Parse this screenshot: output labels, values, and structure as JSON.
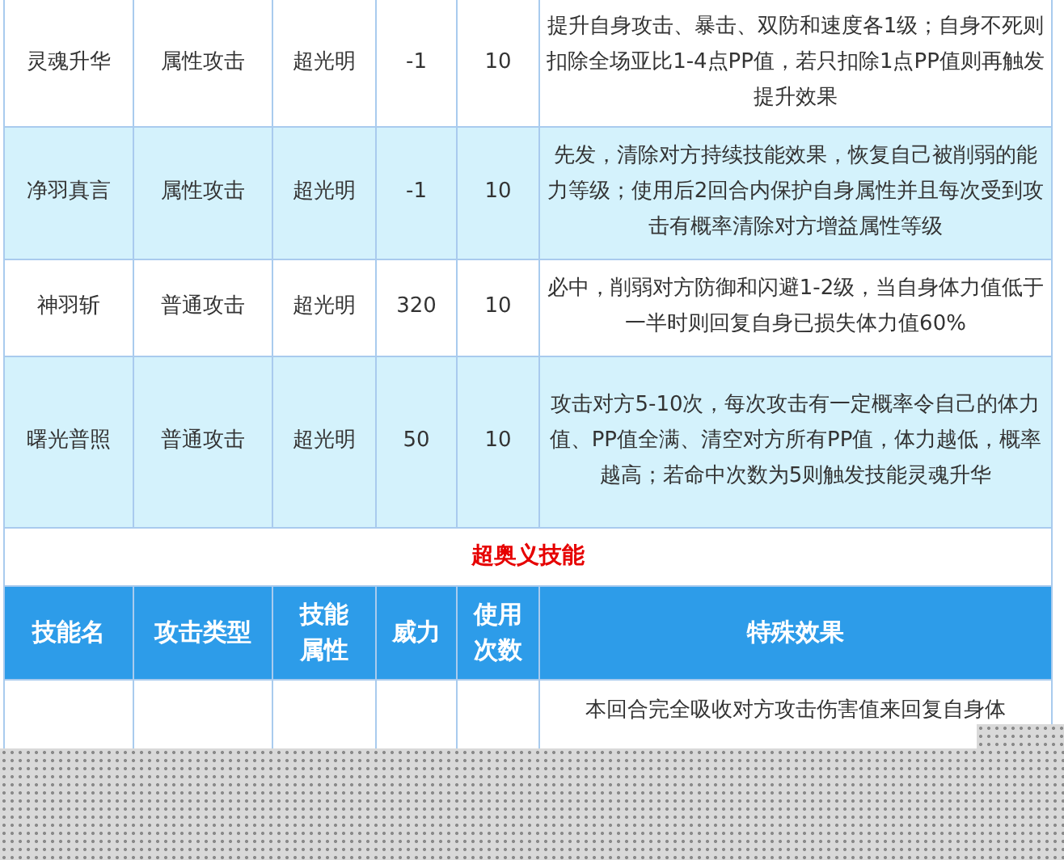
{
  "skills": [
    {
      "name": "灵魂升华",
      "type": "属性攻击",
      "attribute": "超光明",
      "power": "-1",
      "uses": "10",
      "effect": "提升自身攻击、暴击、双防和速度各1级；自身不死则扣除全场亚比1-4点PP值，若只扣除1点PP值则再触发提升效果"
    },
    {
      "name": "净羽真言",
      "type": "属性攻击",
      "attribute": "超光明",
      "power": "-1",
      "uses": "10",
      "effect": "先发，清除对方持续技能效果，恢复自己被削弱的能力等级；使用后2回合内保护自身属性并且每次受到攻击有概率清除对方增益属性等级"
    },
    {
      "name": "神羽斩",
      "type": "普通攻击",
      "attribute": "超光明",
      "power": "320",
      "uses": "10",
      "effect": "必中，削弱对方防御和闪避1-2级，当自身体力值低于一半时则回复自身已损失体力值60%"
    },
    {
      "name": "曙光普照",
      "type": "普通攻击",
      "attribute": "超光明",
      "power": "50",
      "uses": "10",
      "effect": "攻击对方5-10次，每次攻击有一定概率令自己的体力值、PP值全满、清空对方所有PP值，体力越低，概率越高；若命中次数为5则触发技能灵魂升华"
    }
  ],
  "section_title": "超奥义技能",
  "columns": [
    "技能名",
    "攻击类型",
    "技能属性",
    "威力",
    "使用次数",
    "特殊效果"
  ],
  "super_skills": [
    {
      "effect": "本回合完全吸收对方攻击伤害值来回复自身体"
    }
  ]
}
